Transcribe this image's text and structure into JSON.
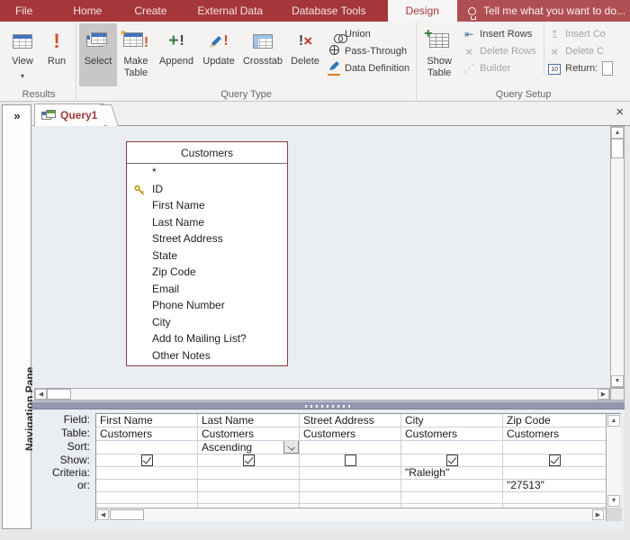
{
  "colors": {
    "ribbon_red": "#A5373B",
    "tellme_red": "#B04F53",
    "active_tab_text": "#A5373B",
    "select_highlight": "#C9C7C5",
    "workspace_bg": "#EAEDF1",
    "splitter_purple": "#9496B1",
    "fieldbox_border": "#8F3B40",
    "run_exclaim": "#D4502C",
    "append_green": "#2E7D46",
    "key_gold": "#C19A1B"
  },
  "ribbon_tabs": {
    "items": [
      "File",
      "Home",
      "Create",
      "External Data",
      "Database Tools",
      "Design"
    ],
    "active": "Design",
    "tell_me": "Tell me what you want to do..."
  },
  "ribbon": {
    "groups": {
      "results": "Results",
      "query_type": "Query Type",
      "query_setup": "Query Setup"
    },
    "view": "View",
    "run": "Run",
    "select": "Select",
    "make_table": "Make Table",
    "append": "Append",
    "update": "Update",
    "crosstab": "Crosstab",
    "delete": "Delete",
    "union": "Union",
    "pass_through": "Pass-Through",
    "data_definition": "Data Definition",
    "show_table": "Show Table",
    "insert_rows": "Insert Rows",
    "delete_rows": "Delete Rows",
    "builder": "Builder",
    "insert_columns": "Insert Co",
    "delete_columns": "Delete C",
    "return_label": "Return:",
    "return_badge": "10"
  },
  "nav_pane": {
    "expand": "»",
    "label": "Navigation Pane"
  },
  "document": {
    "tab_title": "Query1",
    "close": "×"
  },
  "table_box": {
    "title": "Customers",
    "primary_key_field": "ID",
    "fields": [
      "*",
      "ID",
      "First Name",
      "Last Name",
      "Street Address",
      "State",
      "Zip Code",
      "Email",
      "Phone Number",
      "City",
      "Add to Mailing List?",
      "Other Notes"
    ]
  },
  "grid": {
    "row_labels": [
      "Field:",
      "Table:",
      "Sort:",
      "Show:",
      "Criteria:",
      "or:"
    ],
    "columns": [
      {
        "field": "First Name",
        "table": "Customers",
        "sort": "",
        "show": true,
        "criteria": "",
        "or": ""
      },
      {
        "field": "Last Name",
        "table": "Customers",
        "sort": "Ascending",
        "show": true,
        "criteria": "",
        "or": ""
      },
      {
        "field": "Street Address",
        "table": "Customers",
        "sort": "",
        "show": false,
        "criteria": "",
        "or": ""
      },
      {
        "field": "City",
        "table": "Customers",
        "sort": "",
        "show": true,
        "criteria": "\"Raleigh\"",
        "or": ""
      },
      {
        "field": "Zip Code",
        "table": "Customers",
        "sort": "",
        "show": true,
        "criteria": "",
        "or": "\"27513\""
      }
    ]
  }
}
